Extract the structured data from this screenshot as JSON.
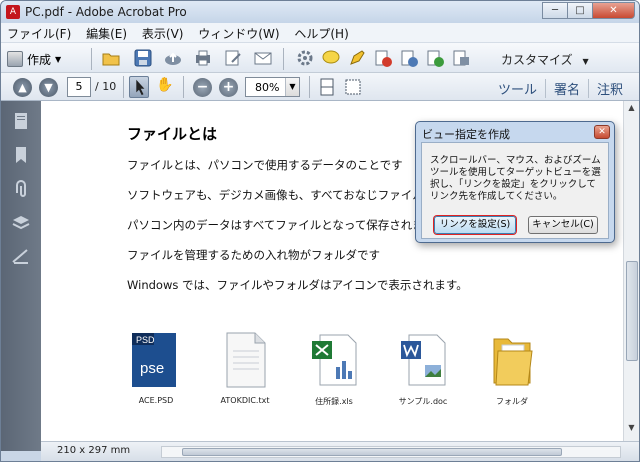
{
  "window": {
    "title": "PC.pdf - Adobe Acrobat Pro",
    "app_icon": "acrobat-icon",
    "buttons": {
      "minimize": "─",
      "maximize": "□",
      "close": "✕"
    }
  },
  "menubar": {
    "items": [
      "ファイル(F)",
      "編集(E)",
      "表示(V)",
      "ウィンドウ(W)",
      "ヘルプ(H)"
    ]
  },
  "toolbar1": {
    "create_label": "作成",
    "customize_label": "カスタマイズ"
  },
  "toolbar2": {
    "page_current": "5",
    "page_total": "/ 10",
    "zoom_value": "80%",
    "links": [
      "ツール",
      "署名",
      "注釈"
    ]
  },
  "document": {
    "title": "ファイルとは",
    "lines": [
      "ファイルとは、パソコンで使用するデータのことです",
      "ソフトウェアも、デジカメ画像も、すべておなじファイルです",
      "パソコン内のデータはすべてファイルとなって保存されます",
      "ファイルを管理するための入れ物がフォルダです",
      "Windows では、ファイルやフォルダはアイコンで表示されます。"
    ],
    "files": [
      {
        "label": "ACE.PSD",
        "icon": "psd-file-icon",
        "badge": "PSD",
        "text": "pse"
      },
      {
        "label": "ATOKDIC.txt",
        "icon": "text-file-icon"
      },
      {
        "label": "住所録.xls",
        "icon": "excel-file-icon"
      },
      {
        "label": "サンプル.doc",
        "icon": "word-file-icon"
      },
      {
        "label": "フォルダ",
        "icon": "folder-icon"
      }
    ]
  },
  "status": {
    "page_size": "210 x 297 mm"
  },
  "dialog": {
    "title": "ビュー指定を作成",
    "message": "スクロールバー、マウス、およびズームツールを使用してターゲットビューを選択し、「リンクを設定」をクリックしてリンク先を作成してください。",
    "ok_label": "リンクを設定(S)",
    "cancel_label": "キャンセル(C)"
  },
  "colors": {
    "highlight": "#e02424",
    "sidebar": "#5b6675",
    "link": "#2d4f7c"
  }
}
